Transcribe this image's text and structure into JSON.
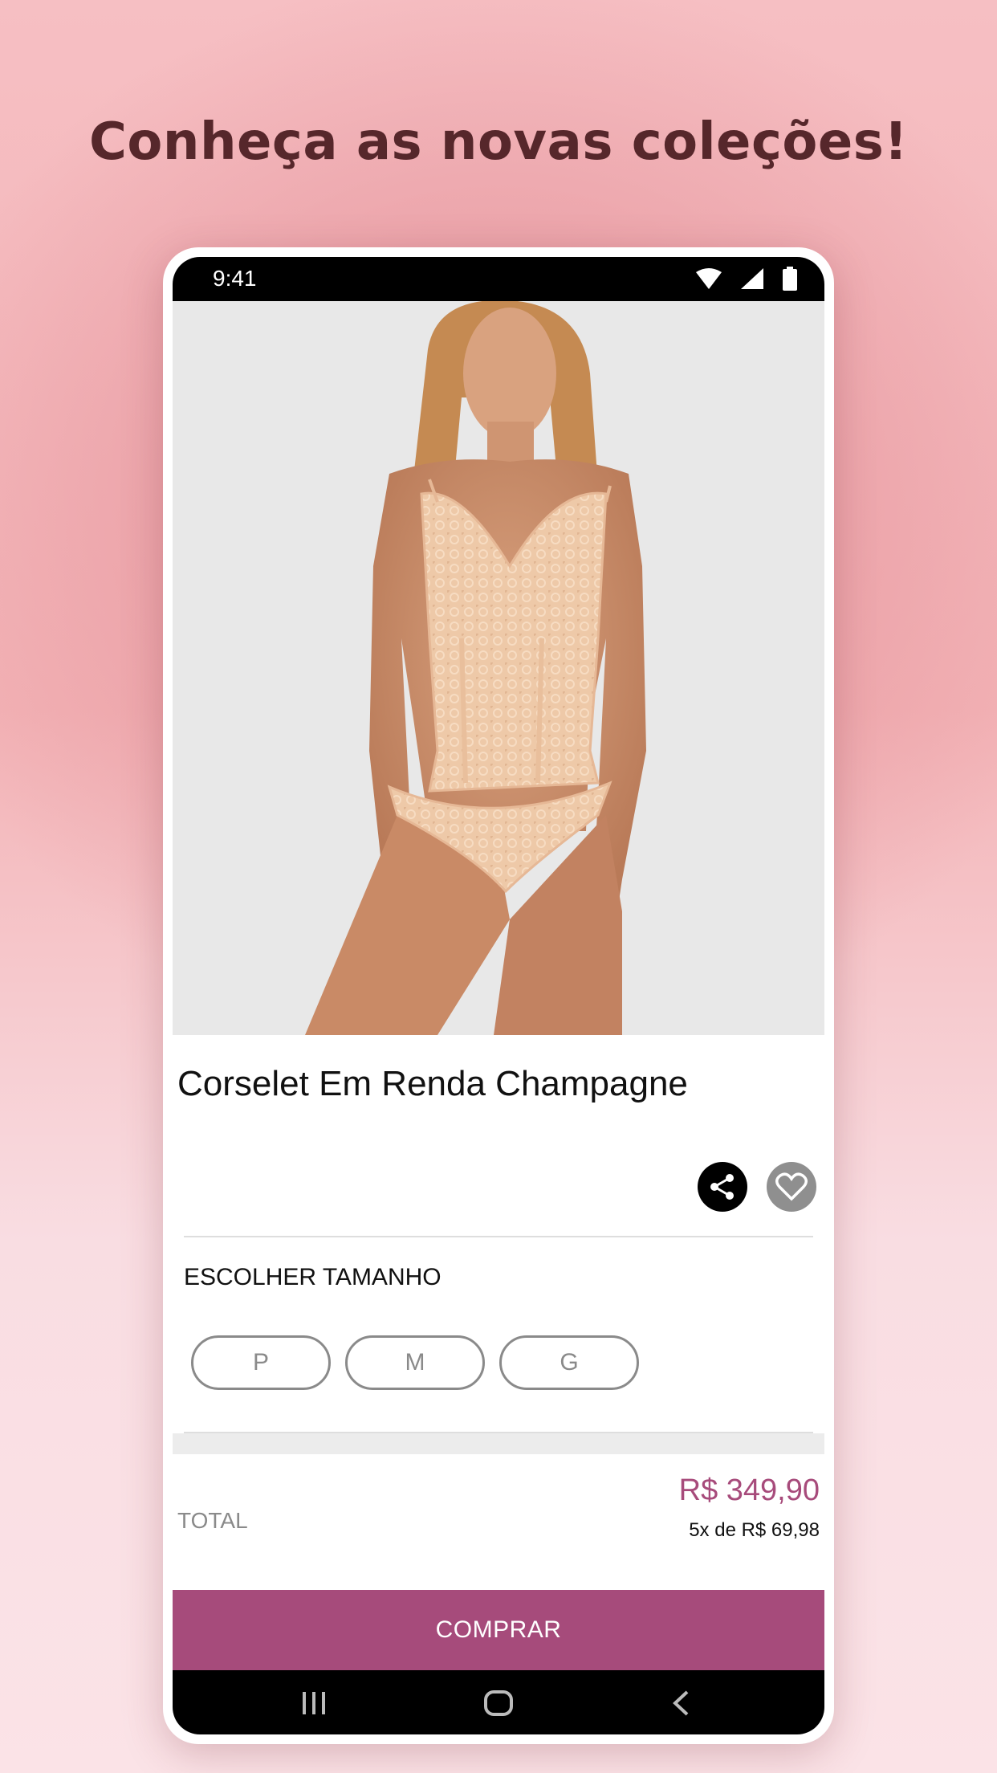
{
  "promo": {
    "headline": "Conheça as novas coleções!"
  },
  "status_bar": {
    "time": "9:41",
    "icons": [
      "wifi-icon",
      "signal-icon",
      "battery-icon"
    ]
  },
  "product": {
    "title": "Corselet Em Renda Champagne",
    "image": "model-photo"
  },
  "actions": {
    "share_icon": "share-icon",
    "favorite_icon": "heart-icon"
  },
  "size": {
    "label": "ESCOLHER TAMANHO",
    "options": [
      "P",
      "M",
      "G"
    ]
  },
  "total": {
    "label": "TOTAL",
    "price": "R$  349,90",
    "installments": "5x de R$  69,98"
  },
  "buy_button": {
    "label": "COMPRAR"
  },
  "nav_bar": {
    "icons": [
      "recent-apps-icon",
      "home-icon",
      "back-icon"
    ]
  },
  "colors": {
    "accent": "#a64b7b",
    "headline": "#56272b",
    "background_pink": "#f6bfc3"
  }
}
